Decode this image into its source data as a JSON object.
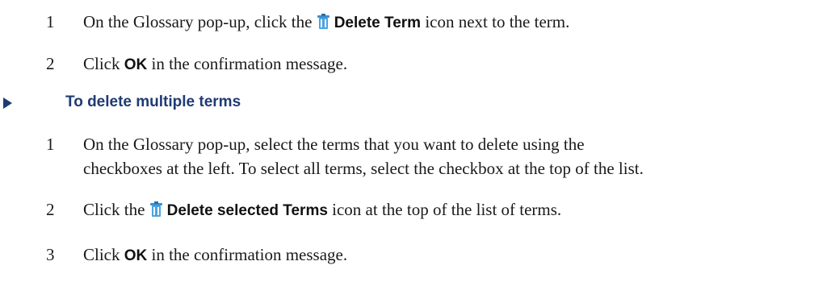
{
  "steps_top": [
    {
      "num": "1",
      "before": "On the Glossary pop-up, click the",
      "ui": "Delete Term",
      "after": " icon next to the term."
    },
    {
      "num": "2",
      "before": "Click ",
      "ui": "OK",
      "after": " in the confirmation message."
    }
  ],
  "section": {
    "heading": "To delete multiple terms"
  },
  "steps_bottom": [
    {
      "num": "1",
      "text_line1": "On the Glossary pop-up, select the terms that you want to delete using the",
      "text_line2": "checkboxes at the left. To select all terms, select the checkbox at the top of the list."
    },
    {
      "num": "2",
      "before": "Click the",
      "ui": "Delete selected Terms",
      "after": " icon at the top of the list of terms."
    },
    {
      "num": "3",
      "before": "Click ",
      "ui": "OK",
      "after": " in the confirmation message."
    }
  ],
  "icons": {
    "delete": "trash-icon"
  },
  "colors": {
    "heading": "#1f3b73",
    "icon": "#3a8fd0"
  }
}
